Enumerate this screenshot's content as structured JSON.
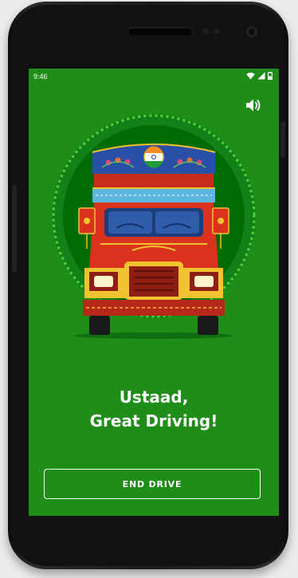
{
  "status_bar": {
    "time": "9:46",
    "icons": [
      "wifi-icon",
      "signal-icon",
      "battery-icon"
    ]
  },
  "header": {
    "sound_icon": "volume-icon"
  },
  "illustration": {
    "subject": "decorated-truck",
    "flag": "india-flag"
  },
  "message": {
    "line1": "Ustaad,",
    "line2": "Great Driving!"
  },
  "actions": {
    "end_drive_label": "END DRIVE"
  },
  "colors": {
    "background": "#1e8e19",
    "medallion_dark": "#036b05",
    "dot_ring": "#4cd136",
    "truck_red": "#d9331e",
    "truck_yellow": "#f2c330",
    "cab_blue": "#2a4fa6"
  }
}
